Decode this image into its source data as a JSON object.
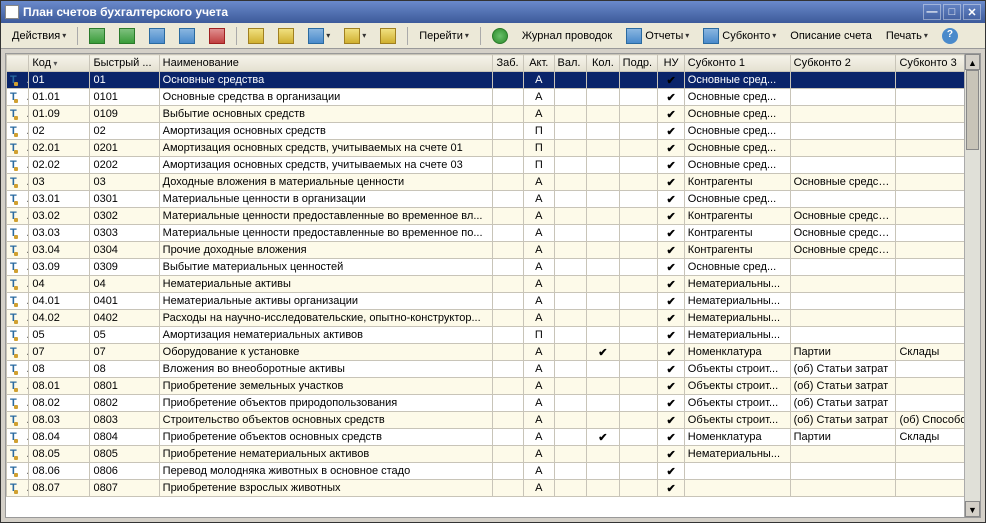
{
  "window": {
    "title": "План счетов бухгалтерского учета"
  },
  "toolbar": {
    "actions": "Действия",
    "goto": "Перейти",
    "journal": "Журнал проводок",
    "reports": "Отчеты",
    "subkonto": "Субконто",
    "desc": "Описание счета",
    "print": "Печать"
  },
  "columns": {
    "kod": "Код",
    "fast": "Быстрый ...",
    "name": "Наименование",
    "zab": "Заб.",
    "akt": "Акт.",
    "val": "Вал.",
    "kol": "Кол.",
    "podr": "Подр.",
    "nu": "НУ",
    "sub1": "Субконто 1",
    "sub2": "Субконто 2",
    "sub3": "Субконто 3"
  },
  "rows": [
    {
      "sel": true,
      "kod": "01",
      "fast": "01",
      "name": "Основные средства",
      "akt": "А",
      "kol": "",
      "nu": true,
      "sub1": "Основные сред...",
      "sub2": "",
      "sub3": ""
    },
    {
      "kod": "01.01",
      "fast": "0101",
      "name": "Основные средства в организации",
      "akt": "А",
      "kol": "",
      "nu": true,
      "sub1": "Основные сред...",
      "sub2": "",
      "sub3": ""
    },
    {
      "kod": "01.09",
      "fast": "0109",
      "name": "Выбытие основных средств",
      "akt": "А",
      "kol": "",
      "nu": true,
      "sub1": "Основные сред...",
      "sub2": "",
      "sub3": ""
    },
    {
      "kod": "02",
      "fast": "02",
      "name": "Амортизация основных средств",
      "akt": "П",
      "kol": "",
      "nu": true,
      "sub1": "Основные сред...",
      "sub2": "",
      "sub3": ""
    },
    {
      "kod": "02.01",
      "fast": "0201",
      "name": "Амортизация основных средств, учитываемых на счете 01",
      "akt": "П",
      "kol": "",
      "nu": true,
      "sub1": "Основные сред...",
      "sub2": "",
      "sub3": ""
    },
    {
      "kod": "02.02",
      "fast": "0202",
      "name": "Амортизация основных средств, учитываемых на счете 03",
      "akt": "П",
      "kol": "",
      "nu": true,
      "sub1": "Основные сред...",
      "sub2": "",
      "sub3": ""
    },
    {
      "kod": "03",
      "fast": "03",
      "name": "Доходные вложения в материальные ценности",
      "akt": "А",
      "kol": "",
      "nu": true,
      "sub1": "Контрагенты",
      "sub2": "Основные средства",
      "sub3": ""
    },
    {
      "kod": "03.01",
      "fast": "0301",
      "name": "Материальные ценности в организации",
      "akt": "А",
      "kol": "",
      "nu": true,
      "sub1": "Основные сред...",
      "sub2": "",
      "sub3": ""
    },
    {
      "kod": "03.02",
      "fast": "0302",
      "name": "Материальные ценности предоставленные во временное вл...",
      "akt": "А",
      "kol": "",
      "nu": true,
      "sub1": "Контрагенты",
      "sub2": "Основные средства",
      "sub3": ""
    },
    {
      "kod": "03.03",
      "fast": "0303",
      "name": "Материальные ценности предоставленные во временное по...",
      "akt": "А",
      "kol": "",
      "nu": true,
      "sub1": "Контрагенты",
      "sub2": "Основные средства",
      "sub3": ""
    },
    {
      "kod": "03.04",
      "fast": "0304",
      "name": "Прочие доходные вложения",
      "akt": "А",
      "kol": "",
      "nu": true,
      "sub1": "Контрагенты",
      "sub2": "Основные средства",
      "sub3": ""
    },
    {
      "kod": "03.09",
      "fast": "0309",
      "name": "Выбытие материальных ценностей",
      "akt": "А",
      "kol": "",
      "nu": true,
      "sub1": "Основные сред...",
      "sub2": "",
      "sub3": ""
    },
    {
      "kod": "04",
      "fast": "04",
      "name": "Нематериальные активы",
      "akt": "А",
      "kol": "",
      "nu": true,
      "sub1": "Нематериальны...",
      "sub2": "",
      "sub3": ""
    },
    {
      "kod": "04.01",
      "fast": "0401",
      "name": "Нематериальные активы организации",
      "akt": "А",
      "kol": "",
      "nu": true,
      "sub1": "Нематериальны...",
      "sub2": "",
      "sub3": ""
    },
    {
      "kod": "04.02",
      "fast": "0402",
      "name": "Расходы на научно-исследовательские, опытно-конструктор...",
      "akt": "А",
      "kol": "",
      "nu": true,
      "sub1": "Нематериальны...",
      "sub2": "",
      "sub3": ""
    },
    {
      "kod": "05",
      "fast": "05",
      "name": "Амортизация нематериальных активов",
      "akt": "П",
      "kol": "",
      "nu": true,
      "sub1": "Нематериальны...",
      "sub2": "",
      "sub3": ""
    },
    {
      "kod": "07",
      "fast": "07",
      "name": "Оборудование к установке",
      "akt": "А",
      "kol": "✔",
      "nu": true,
      "sub1": "Номенклатура",
      "sub2": "Партии",
      "sub3": "Склады"
    },
    {
      "kod": "08",
      "fast": "08",
      "name": "Вложения во внеоборотные активы",
      "akt": "А",
      "kol": "",
      "nu": true,
      "sub1": "Объекты строит...",
      "sub2": "(об) Статьи затрат",
      "sub3": ""
    },
    {
      "kod": "08.01",
      "fast": "0801",
      "name": "Приобретение земельных участков",
      "akt": "А",
      "kol": "",
      "nu": true,
      "sub1": "Объекты строит...",
      "sub2": "(об) Статьи затрат",
      "sub3": ""
    },
    {
      "kod": "08.02",
      "fast": "0802",
      "name": "Приобретение объектов природопользования",
      "akt": "А",
      "kol": "",
      "nu": true,
      "sub1": "Объекты строит...",
      "sub2": "(об) Статьи затрат",
      "sub3": ""
    },
    {
      "kod": "08.03",
      "fast": "0803",
      "name": "Строительство объектов основных средств",
      "akt": "А",
      "kol": "",
      "nu": true,
      "sub1": "Объекты строит...",
      "sub2": "(об) Статьи затрат",
      "sub3": "(об) Способо..."
    },
    {
      "kod": "08.04",
      "fast": "0804",
      "name": "Приобретение объектов основных средств",
      "akt": "А",
      "kol": "✔",
      "nu": true,
      "sub1": "Номенклатура",
      "sub2": "Партии",
      "sub3": "Склады"
    },
    {
      "kod": "08.05",
      "fast": "0805",
      "name": "Приобретение нематериальных активов",
      "akt": "А",
      "kol": "",
      "nu": true,
      "sub1": "Нематериальны...",
      "sub2": "",
      "sub3": ""
    },
    {
      "kod": "08.06",
      "fast": "0806",
      "name": "Перевод молодняка животных в основное стадо",
      "akt": "А",
      "kol": "",
      "nu": true,
      "sub1": "",
      "sub2": "",
      "sub3": ""
    },
    {
      "kod": "08.07",
      "fast": "0807",
      "name": "Приобретение взрослых животных",
      "akt": "А",
      "kol": "",
      "nu": true,
      "sub1": "",
      "sub2": "",
      "sub3": ""
    }
  ]
}
